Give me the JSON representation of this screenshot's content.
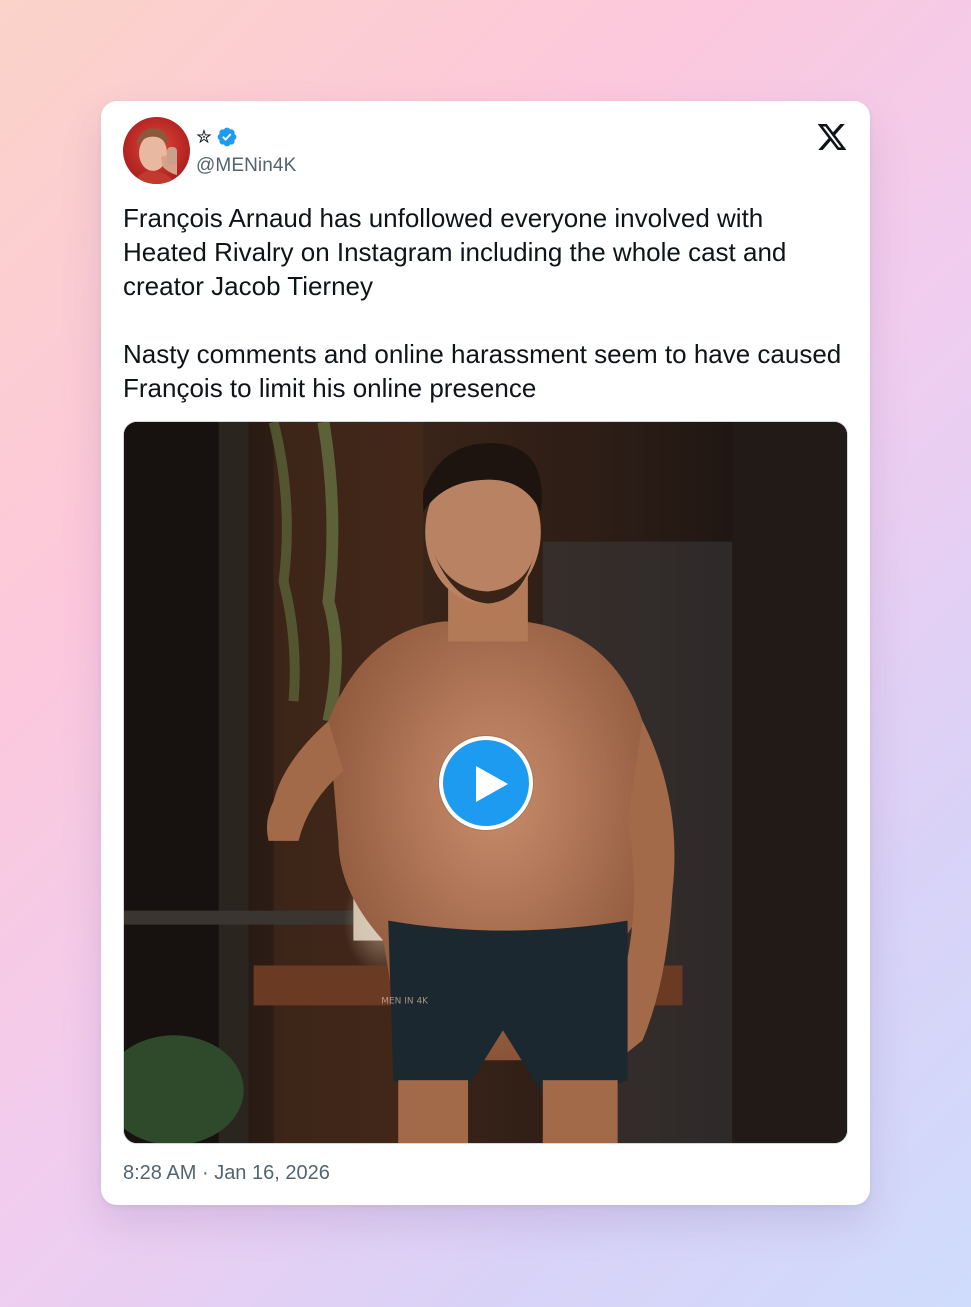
{
  "tweet": {
    "author": {
      "display_name": "✮",
      "verified": true,
      "handle": "@MENin4K",
      "avatar_icon": "profile-photo"
    },
    "platform_icon": "x-logo-icon",
    "paragraphs": [
      "François Arnaud has unfollowed everyone involved with Heated Rivalry on Instagram including the whole cast and creator Jacob Tierney",
      "Nasty comments and online harassment seem to have caused François to limit his online presence"
    ],
    "media": {
      "type": "video",
      "play_icon": "play-icon",
      "watermark": "MEN IN 4K"
    },
    "time": "8:28 AM",
    "separator": "·",
    "date": "Jan 16, 2026"
  },
  "colors": {
    "text_primary": "#0f1419",
    "text_secondary": "#536471",
    "accent_blue": "#1d9bf0",
    "card_bg": "#ffffff"
  }
}
